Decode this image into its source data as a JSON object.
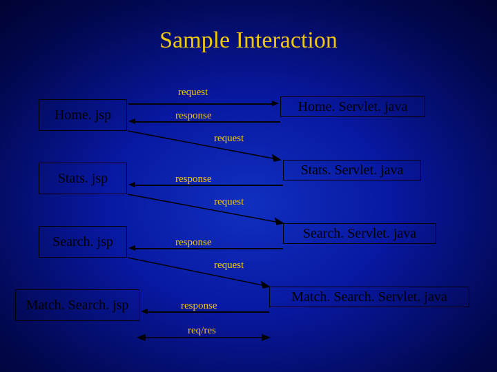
{
  "title": "Sample Interaction",
  "rows": [
    {
      "left": "Home. jsp",
      "right": "Home. Servlet. java",
      "req": "request",
      "res": "response"
    },
    {
      "left": "Stats. jsp",
      "right": "Stats. Servlet. java",
      "req": "request",
      "res": "response"
    },
    {
      "left": "Search. jsp",
      "right": "Search. Servlet. java",
      "req": "request",
      "res": "response"
    },
    {
      "left": "Match. Search. jsp",
      "right": "Match. Search. Servlet. java",
      "req": "request",
      "res": "response"
    }
  ],
  "bottom_label": "req/res"
}
